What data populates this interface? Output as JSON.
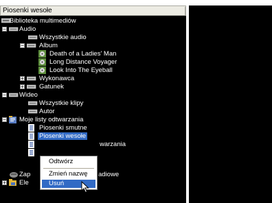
{
  "header": {
    "title": "Piosenki wesołe"
  },
  "tree": [
    {
      "label": "Biblioteka multimediów",
      "level": 0,
      "expander": "",
      "icon": "library-icon"
    },
    {
      "label": "Audio",
      "level": 1,
      "expander": "−",
      "icon": "folder-icon"
    },
    {
      "label": "Wszystkie audio",
      "level": 2,
      "expander": "",
      "icon": "folder-icon"
    },
    {
      "label": "Album",
      "level": 2,
      "expander": "−",
      "icon": "folder-icon"
    },
    {
      "label": "Death of a Ladies' Man",
      "level": 3,
      "expander": "",
      "icon": "album-icon"
    },
    {
      "label": "Long Distance Voyager",
      "level": 3,
      "expander": "",
      "icon": "album-icon"
    },
    {
      "label": "Look Into The Eyeball",
      "level": 3,
      "expander": "",
      "icon": "album-icon"
    },
    {
      "label": "Wykonawca",
      "level": 2,
      "expander": "+",
      "icon": "folder-icon"
    },
    {
      "label": "Gatunek",
      "level": 2,
      "expander": "+",
      "icon": "folder-icon"
    },
    {
      "label": "Wideo",
      "level": 1,
      "expander": "−",
      "icon": "folder-icon"
    },
    {
      "label": "Wszystkie klipy",
      "level": 2,
      "expander": "",
      "icon": "folder-icon"
    },
    {
      "label": "Autor",
      "level": 2,
      "expander": "",
      "icon": "folder-icon"
    },
    {
      "label": "Moje listy odtwarzania",
      "level": 1,
      "expander": "−",
      "icon": "playlists-icon"
    },
    {
      "label": "Piosenki smutne",
      "level": 2,
      "expander": "",
      "icon": "playlist-icon"
    },
    {
      "label": "Piosenki wesołe",
      "level": 2,
      "expander": "",
      "icon": "playlist-icon",
      "selected": true
    },
    {
      "label": "warzania",
      "level": 2,
      "expander": "",
      "icon": "playlist-icon"
    },
    {
      "label": "",
      "level": 2,
      "expander": "",
      "icon": "playlist-icon"
    },
    {
      "label": "Zap",
      "level": 1,
      "expander": "",
      "icon": "radio-icon",
      "suffix": "adiowe"
    },
    {
      "label": "Ele",
      "level": 1,
      "expander": "+",
      "icon": "folder-icon"
    }
  ],
  "context_menu": {
    "items": [
      "Odtwórz",
      "Zmień nazwę",
      "Usuń"
    ],
    "highlighted": "Usuń"
  }
}
